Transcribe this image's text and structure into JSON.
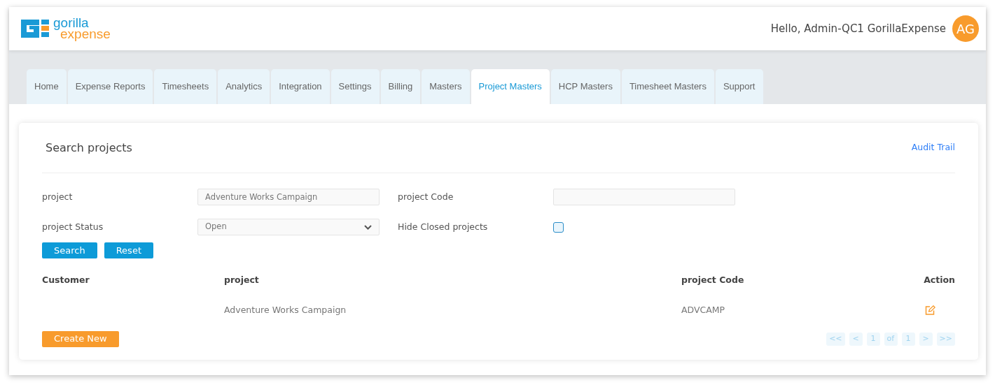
{
  "logo": {
    "word_1": "gorilla",
    "word_2": "expense"
  },
  "user": {
    "greeting": "Hello, Admin-QC1 GorillaExpense",
    "initials": "AG"
  },
  "tabs": [
    {
      "label": "Home",
      "selected": false
    },
    {
      "label": "Expense Reports",
      "selected": false
    },
    {
      "label": "Timesheets",
      "selected": false
    },
    {
      "label": "Analytics",
      "selected": false
    },
    {
      "label": "Integration",
      "selected": false
    },
    {
      "label": "Settings",
      "selected": false
    },
    {
      "label": "Billing",
      "selected": false
    },
    {
      "label": "Masters",
      "selected": false
    },
    {
      "label": "Project Masters",
      "selected": true
    },
    {
      "label": "HCP Masters",
      "selected": false
    },
    {
      "label": "Timesheet Masters",
      "selected": false
    },
    {
      "label": "Support",
      "selected": false
    }
  ],
  "search_panel": {
    "title": "Search projects",
    "audit_link": "Audit Trail",
    "project_label": "project",
    "project_value": "Adventure Works Campaign",
    "code_label": "project Code",
    "status_label": "project Status",
    "status_value": "Open",
    "hide_closed_label": "Hide Closed projects",
    "hide_closed_checked": false,
    "buttons": [
      "Search",
      "Reset"
    ]
  },
  "table": {
    "columns": [
      "Customer",
      "project",
      "project Code",
      "Action"
    ],
    "rows": [
      {
        "customer": "",
        "project": "Adventure Works Campaign",
        "code": "ADVCAMP"
      }
    ]
  },
  "create_button": "Create New",
  "pagination": [
    "<<",
    "<",
    "1",
    "of",
    "1",
    ">",
    ">>"
  ]
}
